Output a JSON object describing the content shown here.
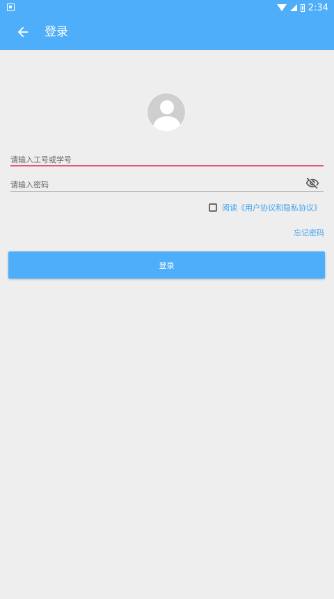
{
  "status_bar": {
    "time": "2:34"
  },
  "app_bar": {
    "title": "登录",
    "back_icon": "arrow-back-icon"
  },
  "form": {
    "account_placeholder": "请输入工号或学号",
    "password_placeholder": "请输入密码",
    "agreement_text": "阅读《用户协议和隐私协议》",
    "forgot_password": "忘记密码",
    "login_button": "登录"
  },
  "colors": {
    "primary": "#4faef9",
    "link": "#3ea3f2",
    "focus_underline": "#e05a7a",
    "background": "#eeeeee"
  }
}
